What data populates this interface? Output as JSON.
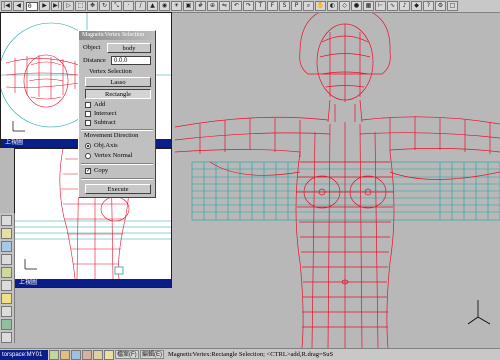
{
  "top_toolbar": {
    "frame_value": "0"
  },
  "viewports": {
    "top_left_title": "上視圖",
    "bottom_left_title": "上視圖"
  },
  "dialog": {
    "title": "MagneticVertex Selection",
    "object_label": "Object",
    "object_value": "body",
    "distance_label": "Distance",
    "distance_value": "0.0.0",
    "vertex_selection_label": "Vertex Selection",
    "lasso_label": "Lasso",
    "rectangle_label": "Rectangle",
    "add_label": "Add",
    "intersect_label": "Intersect",
    "subtract_label": "Subtract",
    "movement_label": "Movement Direction",
    "obj_axis_label": "Obj.Axis",
    "vertex_normal_label": "Vertex Normal",
    "copy_label": "Copy",
    "execute_label": "Execute"
  },
  "status_bar": {
    "name": "torspace:MY01",
    "cell1": "檔案(F)",
    "cell2": "編輯(E)",
    "message": "MagneticVertex:Rectangle Selection; <CTRL>add,R.drag=SuS"
  },
  "colors": {
    "wire": "#e8102a",
    "grid": "#1aa6a6",
    "title_bar": "#0a1e8a",
    "background": "#b8b8b8"
  }
}
